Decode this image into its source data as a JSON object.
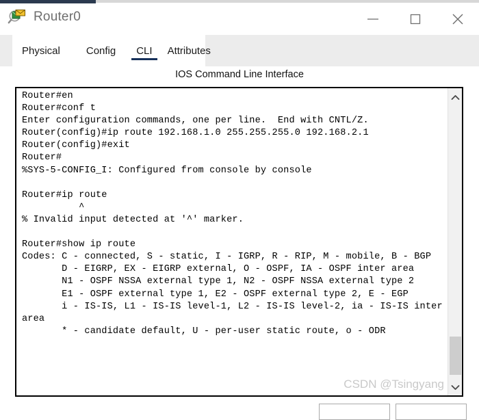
{
  "window": {
    "title": "Router0",
    "app_icon": "inspect-magnifier-icon",
    "controls": {
      "minimize": "minimize-icon",
      "maximize": "maximize-icon",
      "close": "close-icon"
    }
  },
  "tabs": [
    {
      "label": "Physical",
      "active": false
    },
    {
      "label": "Config",
      "active": false
    },
    {
      "label": "CLI",
      "active": true
    },
    {
      "label": "Attributes",
      "active": false
    }
  ],
  "panel": {
    "heading": "IOS Command Line Interface"
  },
  "console": {
    "text": "Router#en\nRouter#conf t\nEnter configuration commands, one per line.  End with CNTL/Z.\nRouter(config)#ip route 192.168.1.0 255.255.255.0 192.168.2.1\nRouter(config)#exit\nRouter#\n%SYS-5-CONFIG_I: Configured from console by console\n\nRouter#ip route\n          ^\n% Invalid input detected at '^' marker.\n\nRouter#show ip route\nCodes: C - connected, S - static, I - IGRP, R - RIP, M - mobile, B - BGP\n       D - EIGRP, EX - EIGRP external, O - OSPF, IA - OSPF inter area\n       N1 - OSPF NSSA external type 1, N2 - OSPF NSSA external type 2\n       E1 - OSPF external type 1, E2 - OSPF external type 2, E - EGP\n       i - IS-IS, L1 - IS-IS level-1, L2 - IS-IS level-2, ia - IS-IS inter area\n       * - candidate default, U - per-user static route, o - ODR"
  },
  "scrollbar": {
    "up_arrow": "chevron-up-icon",
    "down_arrow": "chevron-down-icon"
  },
  "watermark": {
    "text": "CSDN @Tsingyang"
  },
  "colors": {
    "tab_accent": "#15305a",
    "console_border": "#000000",
    "titlebar_text": "#6e6e6e",
    "scrollbar_thumb": "#cdcdcd",
    "tabstrip_bg": "#ececec"
  }
}
